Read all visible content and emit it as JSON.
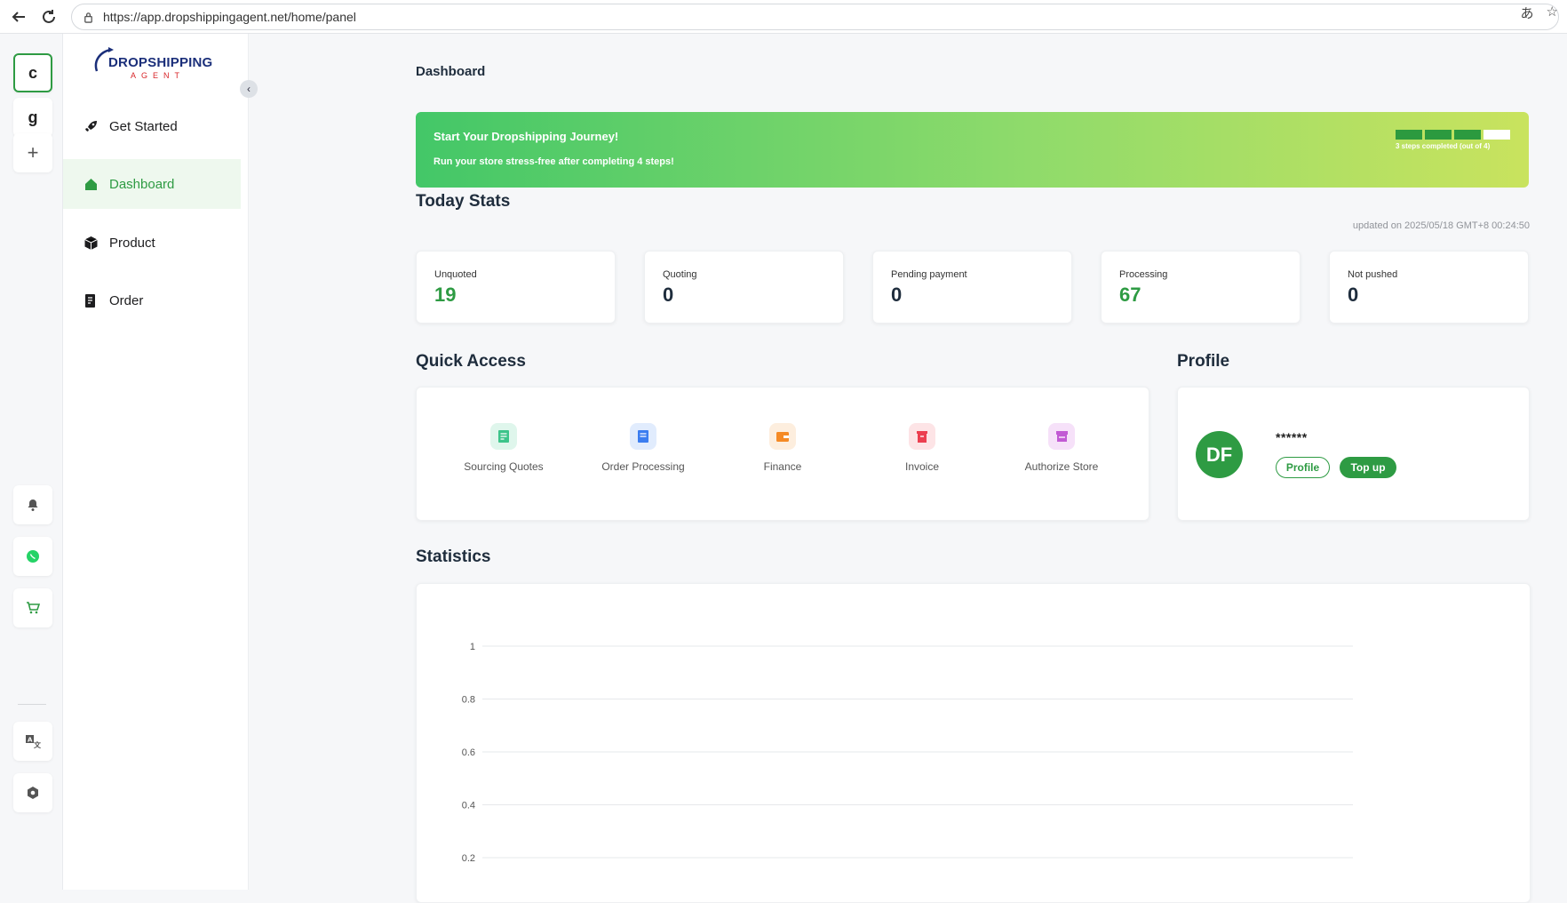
{
  "browser": {
    "url": "https://app.dropshippingagent.net/home/panel",
    "translate_icon": "translate-icon",
    "star_icon": "star-icon"
  },
  "rail": {
    "stores": [
      "c",
      "g"
    ],
    "add_label": "+"
  },
  "sidebar": {
    "logo_word": "DROPSHIPPING",
    "logo_sub": "AGENT",
    "items": [
      {
        "label": "Get Started",
        "icon": "rocket-icon"
      },
      {
        "label": "Dashboard",
        "icon": "home-icon"
      },
      {
        "label": "Product",
        "icon": "box-icon"
      },
      {
        "label": "Order",
        "icon": "order-icon"
      }
    ]
  },
  "main": {
    "page_title": "Dashboard",
    "banner": {
      "title": "Start Your Dropshipping Journey!",
      "subtitle": "Run your store stress-free after completing 4 steps!",
      "steps_text": "3 steps completed (out of 4)",
      "steps_completed": 3,
      "steps_total": 4
    },
    "today_stats": {
      "title": "Today Stats",
      "updated": "updated on 2025/05/18 GMT+8 00:24:50",
      "cards": [
        {
          "label": "Unquoted",
          "value": "19"
        },
        {
          "label": "Quoting",
          "value": "0"
        },
        {
          "label": "Pending payment",
          "value": "0"
        },
        {
          "label": "Processing",
          "value": "67"
        },
        {
          "label": "Not pushed",
          "value": "0"
        }
      ]
    },
    "quick_access": {
      "title": "Quick Access",
      "items": [
        {
          "label": "Sourcing Quotes",
          "icon": "sourcing-quotes-icon"
        },
        {
          "label": "Order Processing",
          "icon": "order-processing-icon"
        },
        {
          "label": "Finance",
          "icon": "wallet-icon"
        },
        {
          "label": "Invoice",
          "icon": "invoice-icon"
        },
        {
          "label": "Authorize Store",
          "icon": "authorize-store-icon"
        }
      ]
    },
    "profile": {
      "title": "Profile",
      "avatar_initials": "DF",
      "name": "******",
      "profile_button": "Profile",
      "topup_button": "Top up"
    },
    "statistics": {
      "title": "Statistics"
    }
  },
  "colors": {
    "accent": "#2e9b43",
    "banner_start": "#43c768",
    "banner_end": "#c9e35e"
  },
  "chart_data": {
    "type": "line",
    "title": "",
    "ylim": [
      0,
      1
    ],
    "y_ticks_visible": [
      "1",
      "0.8",
      "0.6",
      "0.4",
      "0.2"
    ],
    "grid": true,
    "series": []
  }
}
